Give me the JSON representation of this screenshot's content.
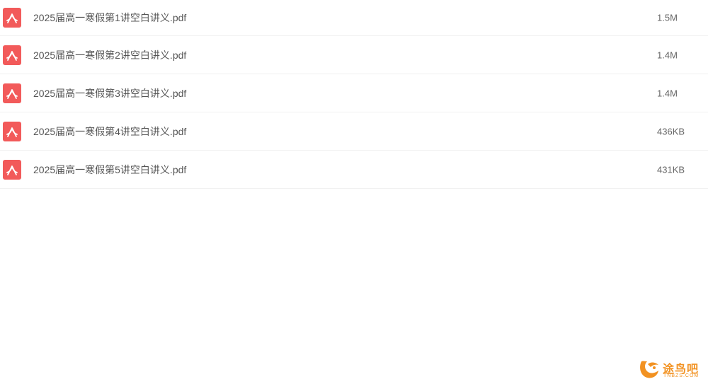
{
  "files": [
    {
      "name": "2025届高一寒假第1讲空白讲义.pdf",
      "size": "1.5M",
      "icon": "pdf-icon"
    },
    {
      "name": "2025届高一寒假第2讲空白讲义.pdf",
      "size": "1.4M",
      "icon": "pdf-icon"
    },
    {
      "name": "2025届高一寒假第3讲空白讲义.pdf",
      "size": "1.4M",
      "icon": "pdf-icon"
    },
    {
      "name": "2025届高一寒假第4讲空白讲义.pdf",
      "size": "436KB",
      "icon": "pdf-icon"
    },
    {
      "name": "2025届高一寒假第5讲空白讲义.pdf",
      "size": "431KB",
      "icon": "pdf-icon"
    }
  ],
  "watermark": {
    "text": "途鸟吧",
    "subtext": "TNBZS.COM"
  },
  "colors": {
    "pdf_icon": "#f25a5a",
    "watermark": "#f29222"
  }
}
